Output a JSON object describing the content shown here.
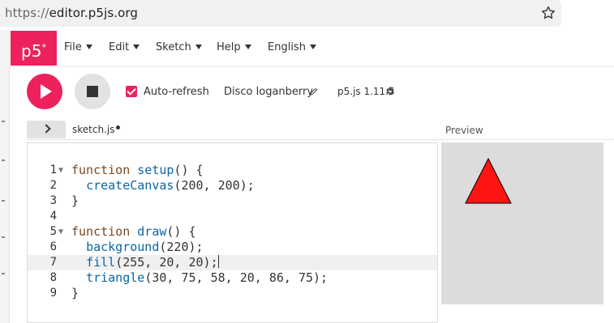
{
  "browser": {
    "url_scheme": "https://",
    "url_host": "editor.p5js.org",
    "bookmark_icon": "star-icon"
  },
  "nav": {
    "logo": "p5",
    "logo_sup": "*",
    "menus": [
      "File",
      "Edit",
      "Sketch",
      "Help",
      "English"
    ]
  },
  "toolbar": {
    "play_icon": "play-icon",
    "stop_icon": "stop-icon",
    "auto_refresh_label": "Auto-refresh",
    "auto_refresh_checked": true,
    "sketch_name": "Disco loganberry",
    "version": "p5.js 1.11.5"
  },
  "editor": {
    "tab_name": "sketch.js",
    "unsaved": true,
    "preview_label": "Preview",
    "active_line": 7,
    "lines": [
      [
        {
          "t": "kw",
          "v": "function "
        },
        {
          "t": "fn",
          "v": "setup"
        },
        {
          "t": "pl",
          "v": "() {"
        }
      ],
      [
        {
          "t": "pl",
          "v": "  "
        },
        {
          "t": "fn",
          "v": "createCanvas"
        },
        {
          "t": "pl",
          "v": "(200, 200);"
        }
      ],
      [
        {
          "t": "pl",
          "v": "}"
        }
      ],
      [],
      [
        {
          "t": "kw",
          "v": "function "
        },
        {
          "t": "fn",
          "v": "draw"
        },
        {
          "t": "pl",
          "v": "() {"
        }
      ],
      [
        {
          "t": "pl",
          "v": "  "
        },
        {
          "t": "fn",
          "v": "background"
        },
        {
          "t": "pl",
          "v": "(220);"
        }
      ],
      [
        {
          "t": "pl",
          "v": "  "
        },
        {
          "t": "fn",
          "v": "fill"
        },
        {
          "t": "pl",
          "v": "(255, 20, 20);"
        }
      ],
      [
        {
          "t": "pl",
          "v": "  "
        },
        {
          "t": "fn",
          "v": "triangle"
        },
        {
          "t": "pl",
          "v": "(30, 75, 58, 20, 86, 75);"
        }
      ],
      [
        {
          "t": "pl",
          "v": "}"
        }
      ]
    ]
  },
  "preview": {
    "canvas_background": "#dcdcdc",
    "triangle_fill": "#ff1414",
    "triangle_points": [
      [
        30,
        75
      ],
      [
        58,
        20
      ],
      [
        86,
        75
      ]
    ]
  },
  "colors": {
    "accent": "#ed225d"
  }
}
